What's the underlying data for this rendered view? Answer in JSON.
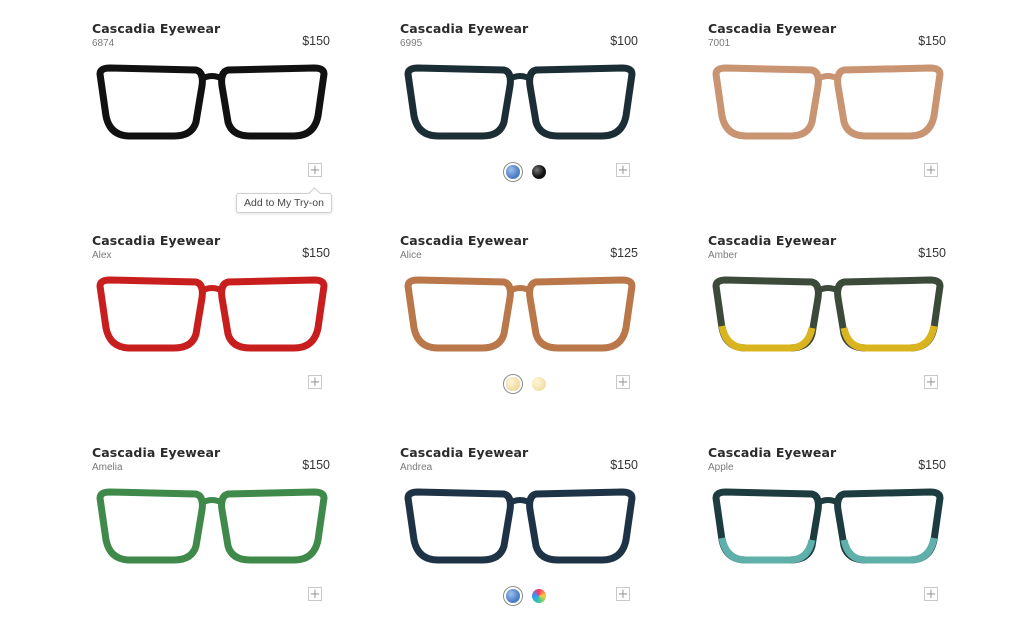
{
  "products": [
    {
      "brand": "Cascadia Eyewear",
      "model": "6874",
      "price": "$150",
      "add_label": "+",
      "colors": {
        "frame": "#111111",
        "lens": "#ffffff",
        "temple": "#1a1a1a"
      }
    },
    {
      "brand": "Cascadia Eyewear",
      "model": "6995",
      "price": "$100",
      "add_label": "+",
      "colors": {
        "frame": "#1c2e35",
        "lens": "#ffffff",
        "temple": "#22363d"
      },
      "swatches": [
        {
          "name": "blue-swatch",
          "color": "#4f7fc3",
          "selected": true
        },
        {
          "name": "black-swatch",
          "color": "#111111",
          "selected": false
        }
      ]
    },
    {
      "brand": "Cascadia Eyewear",
      "model": "7001",
      "price": "$150",
      "add_label": "+",
      "colors": {
        "frame": "#c89472",
        "lens": "#ffffff",
        "temple": "#c89472"
      }
    },
    {
      "brand": "Cascadia Eyewear",
      "model": "Alex",
      "price": "$150",
      "add_label": "+",
      "colors": {
        "frame": "#c81e1e",
        "lens": "#ffffff",
        "temple": "#e0301e"
      }
    },
    {
      "brand": "Cascadia Eyewear",
      "model": "Alice",
      "price": "$125",
      "add_label": "+",
      "colors": {
        "frame": "#b9774a",
        "lens": "#ffffff",
        "temple": "#c99a3a"
      },
      "swatches": [
        {
          "name": "light-gold-swatch",
          "color": "#f0dba0",
          "selected": true
        },
        {
          "name": "gold-swatch",
          "color": "#f2e1a8",
          "selected": false
        }
      ]
    },
    {
      "brand": "Cascadia Eyewear",
      "model": "Amber",
      "price": "$150",
      "add_label": "+",
      "colors": {
        "frame": "#3c4a3a",
        "lens": "#ffffff",
        "temple": "#2d3b33",
        "accent": "#d9b41e"
      }
    },
    {
      "brand": "Cascadia Eyewear",
      "model": "Amelia",
      "price": "$150",
      "add_label": "+",
      "colors": {
        "frame": "#3f8a4a",
        "lens": "#ffffff",
        "temple": "#3d8547"
      }
    },
    {
      "brand": "Cascadia Eyewear",
      "model": "Andrea",
      "price": "$150",
      "add_label": "+",
      "colors": {
        "frame": "#1f3346",
        "lens": "#ffffff",
        "temple": "#1a2a3a"
      },
      "swatches": [
        {
          "name": "blue-swatch",
          "color": "#4f7fc3",
          "selected": true
        },
        {
          "name": "multicolor-swatch",
          "color": "#d070d0",
          "selected": false
        }
      ]
    },
    {
      "brand": "Cascadia Eyewear",
      "model": "Apple",
      "price": "$150",
      "add_label": "+",
      "colors": {
        "frame": "#1c3c40",
        "lens": "#ffffff",
        "temple": "#1a2326",
        "accent": "#5fb0aa"
      }
    }
  ],
  "tooltip": {
    "label": "Add to My Try-on"
  }
}
